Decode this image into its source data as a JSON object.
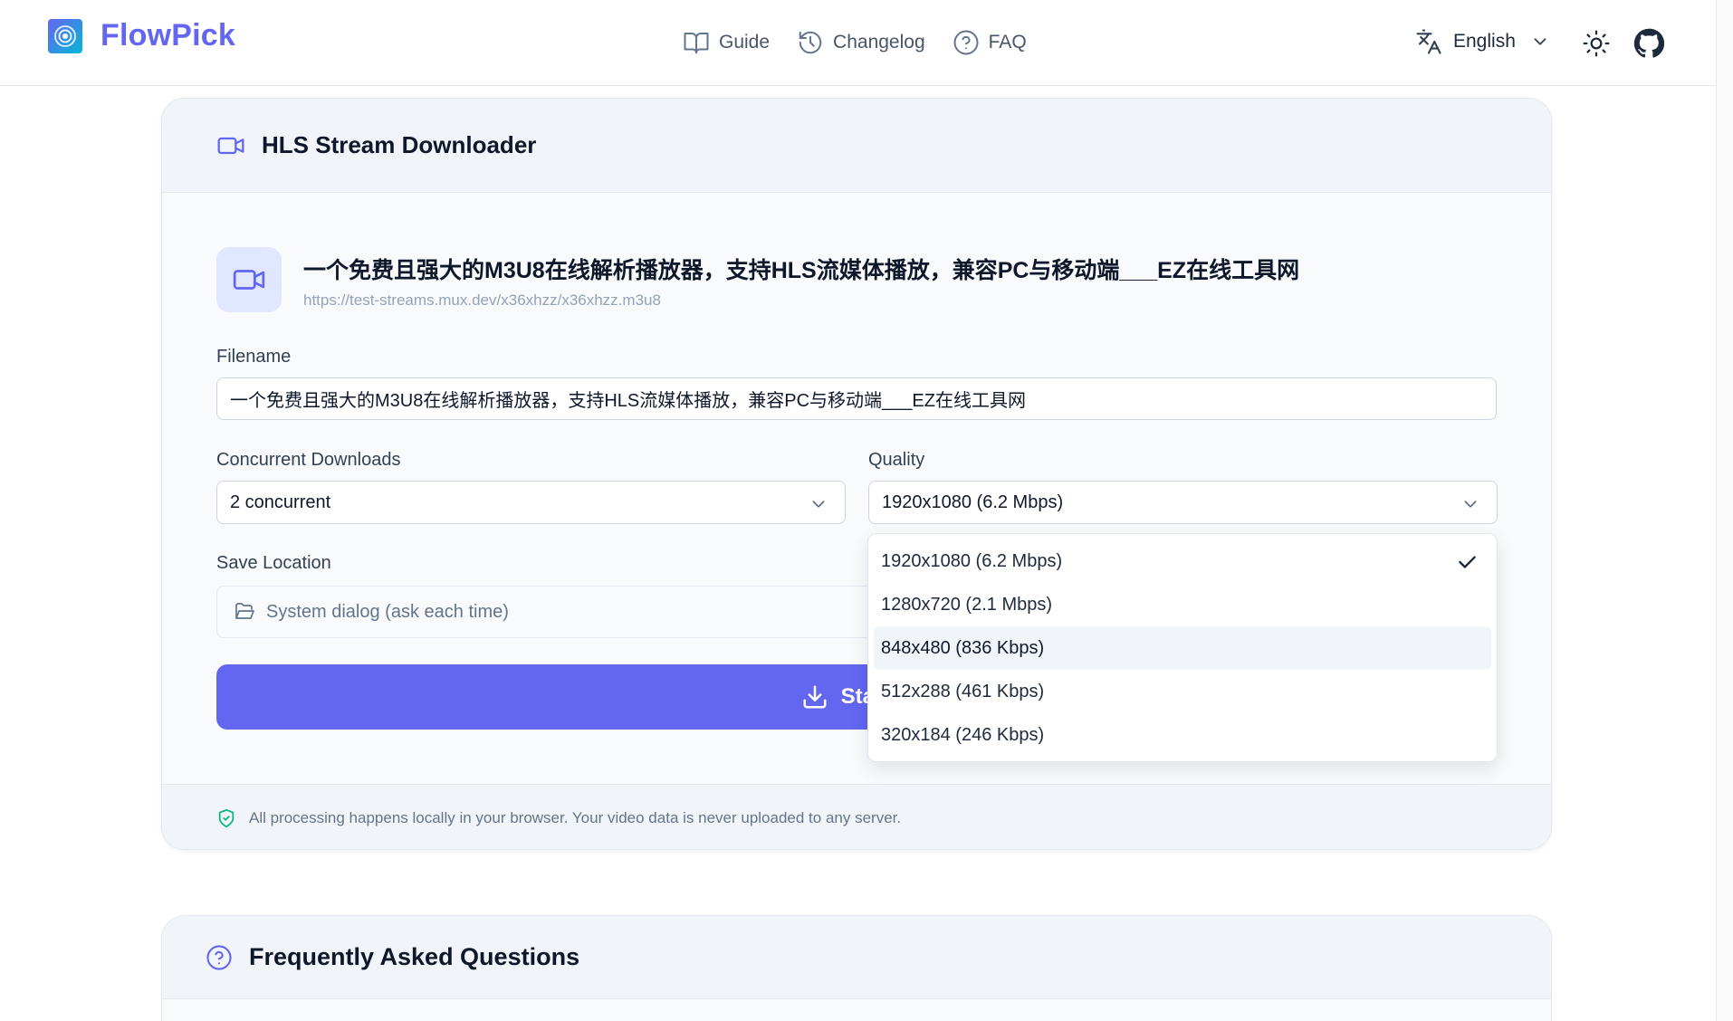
{
  "app": {
    "brand": "FlowPick",
    "accent_color": "#6366f1"
  },
  "nav": [
    {
      "label": "Guide",
      "icon": "book-icon"
    },
    {
      "label": "Changelog",
      "icon": "history-icon"
    },
    {
      "label": "FAQ",
      "icon": "help-circle-icon"
    }
  ],
  "language": {
    "label": "English"
  },
  "card": {
    "title": "HLS Stream Downloader",
    "media_title": "一个免费且强大的M3U8在线解析播放器，支持HLS流媒体播放，兼容PC与移动端___EZ在线工具网",
    "media_url": "https://test-streams.mux.dev/x36xhzz/x36xhzz.m3u8",
    "filename_label": "Filename",
    "filename_value": "一个免费且强大的M3U8在线解析播放器，支持HLS流媒体播放，兼容PC与移动端___EZ在线工具网",
    "concurrent_label": "Concurrent Downloads",
    "concurrent_value": "2 concurrent",
    "quality_label": "Quality",
    "quality_value": "1920x1080 (6.2 Mbps)",
    "save_label": "Save Location",
    "save_value": "System dialog (ask each time)",
    "start_label": "Start D",
    "privacy_note": "All processing happens locally in your browser. Your video data is never uploaded to any server."
  },
  "quality_options": [
    {
      "label": "1920x1080 (6.2 Mbps)",
      "selected": true
    },
    {
      "label": "1280x720 (2.1 Mbps)",
      "selected": false
    },
    {
      "label": "848x480 (836 Kbps)",
      "selected": false,
      "hovered": true
    },
    {
      "label": "512x288 (461 Kbps)",
      "selected": false
    },
    {
      "label": "320x184 (246 Kbps)",
      "selected": false
    }
  ],
  "faq": {
    "title": "Frequently Asked Questions"
  }
}
